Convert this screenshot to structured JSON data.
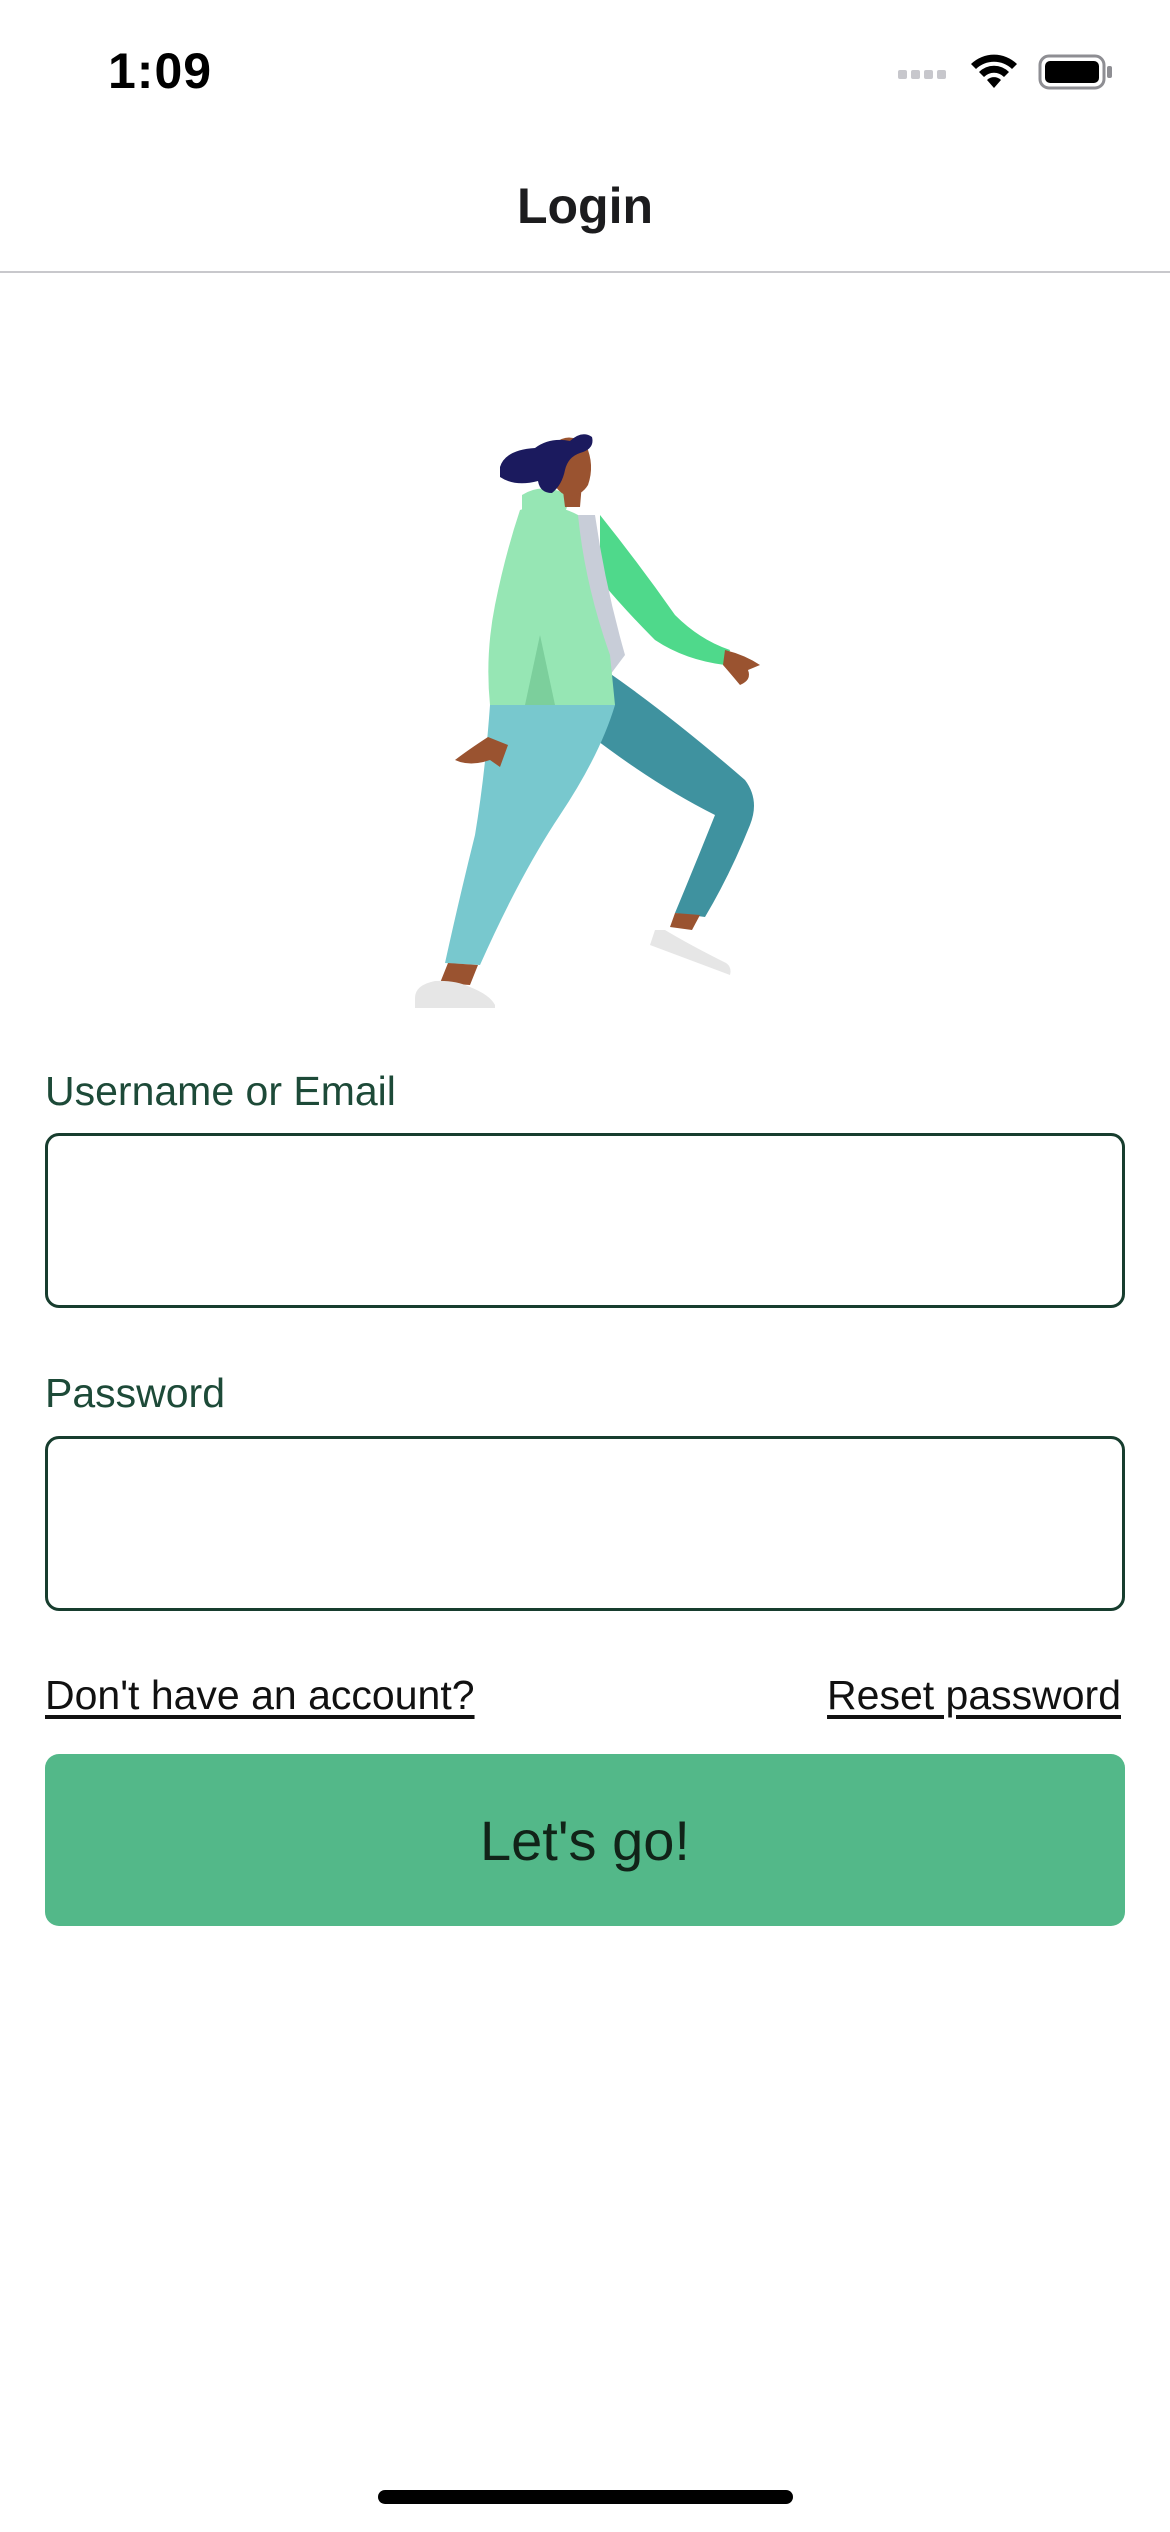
{
  "status_bar": {
    "time": "1:09",
    "icons": [
      "cellular-signal-icon",
      "wifi-icon",
      "battery-icon"
    ]
  },
  "nav": {
    "title": "Login"
  },
  "illustration": {
    "name": "walking-person-illustration",
    "colors": {
      "hair": "#1b1a5e",
      "skin": "#9a5330",
      "jacket_light": "#96e6b4",
      "jacket_sleeve": "#4fd98b",
      "shirt": "#c8cdd8",
      "pants_light": "#78c8ce",
      "pants_dark": "#3f929f",
      "shoes": "#e6e6e6"
    }
  },
  "form": {
    "username_label": "Username or Email",
    "username_value": "",
    "password_label": "Password",
    "password_value": ""
  },
  "links": {
    "signup": "Don't have an account?",
    "reset": "Reset password"
  },
  "submit": {
    "label": "Let's go!"
  },
  "colors": {
    "accent": "#53b889",
    "label_text": "#1d4a38",
    "input_border": "#173d2e"
  }
}
